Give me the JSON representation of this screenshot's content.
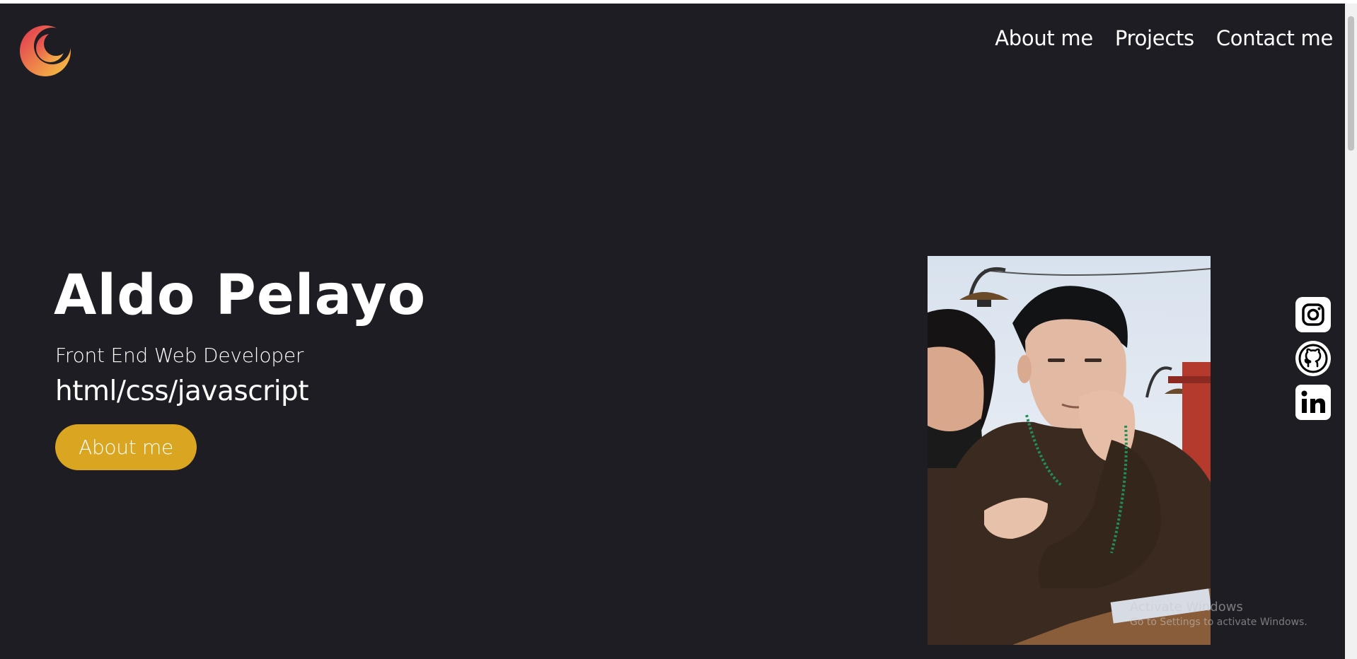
{
  "nav": {
    "items": [
      {
        "label": "About me"
      },
      {
        "label": "Projects"
      },
      {
        "label": "Contact me"
      }
    ]
  },
  "hero": {
    "name": "Aldo Pelayo",
    "subtitle": "Front End Web Developer",
    "tech": "html/css/javascript",
    "cta_label": "About me"
  },
  "social": [
    {
      "icon": "instagram-icon"
    },
    {
      "icon": "github-icon"
    },
    {
      "icon": "linkedin-icon"
    }
  ],
  "colors": {
    "background": "#1e1d24",
    "accent": "#daa520",
    "text": "#ffffff",
    "logo_gradient_start": "#e8324e",
    "logo_gradient_end": "#f6c445"
  },
  "windows_watermark": {
    "title": "Activate Windows",
    "subtitle": "Go to Settings to activate Windows."
  }
}
